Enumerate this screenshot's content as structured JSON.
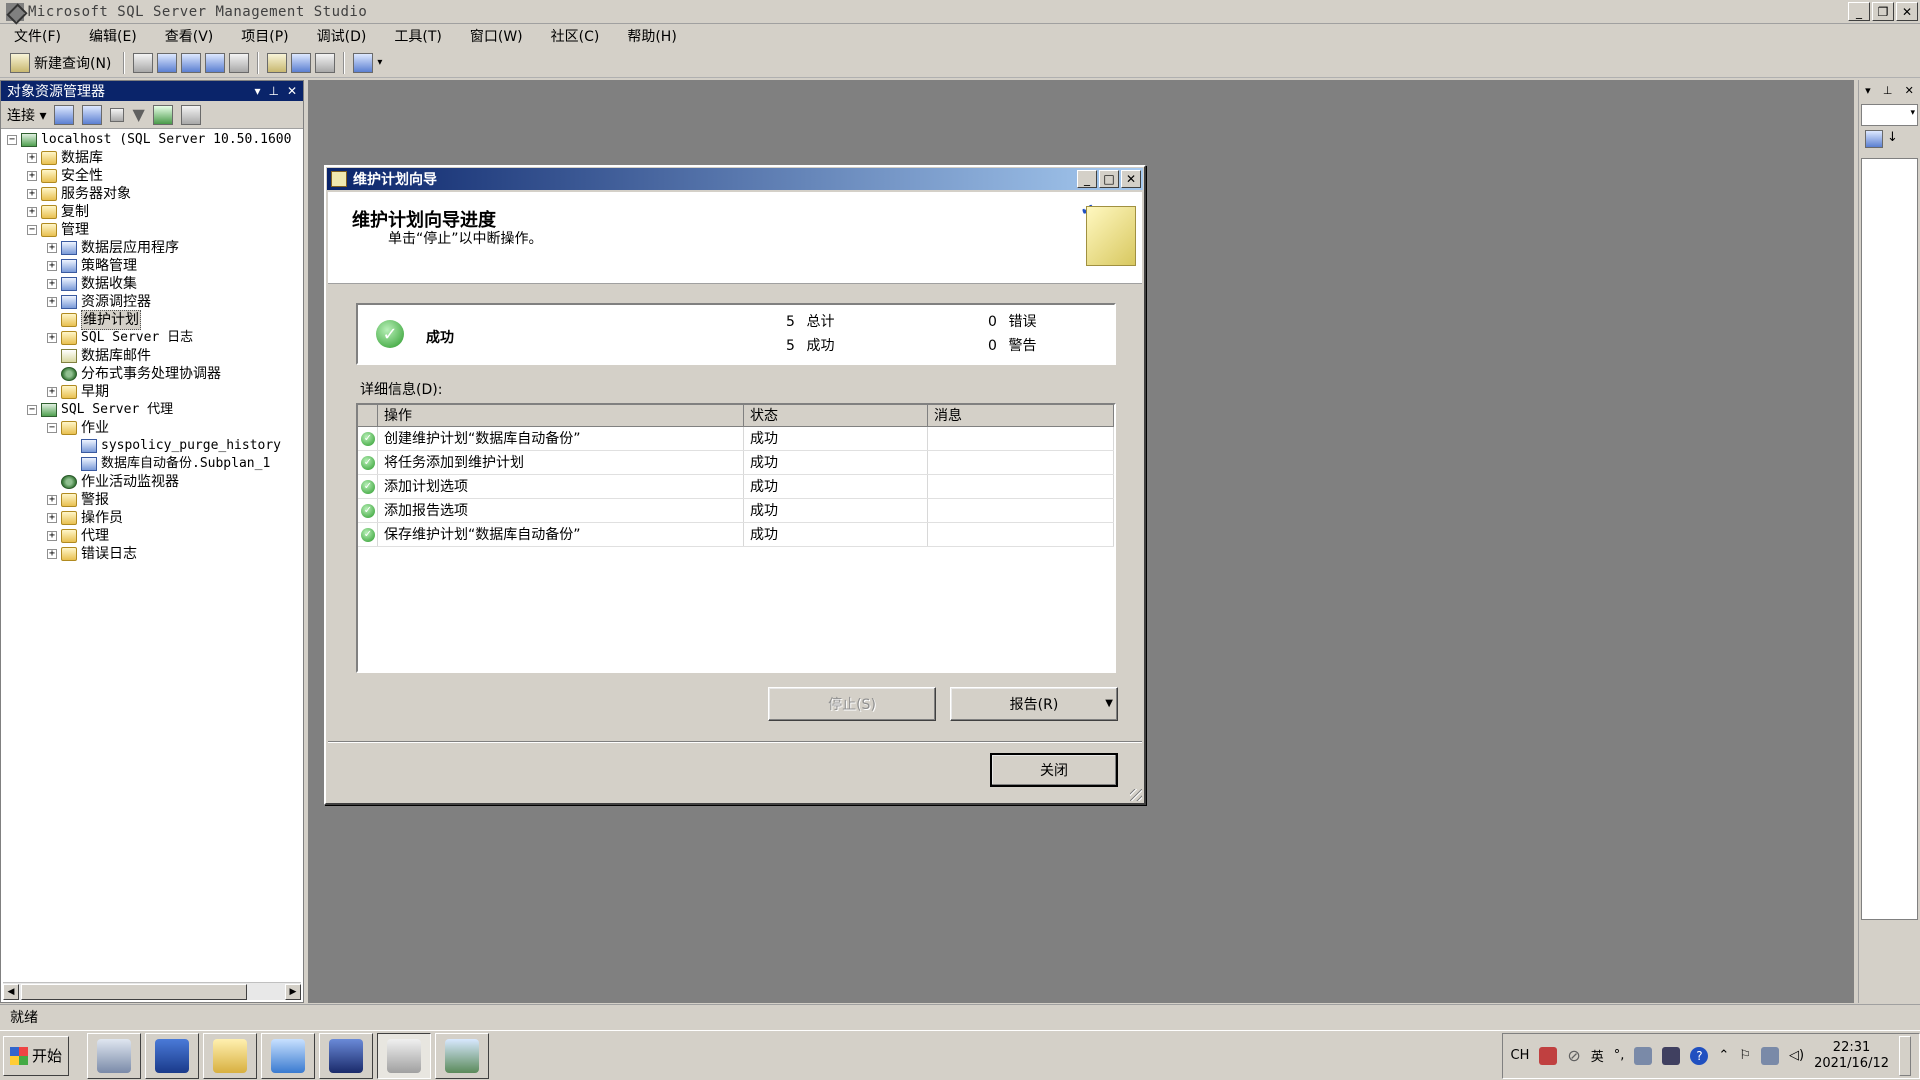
{
  "window": {
    "title": "Microsoft SQL Server Management Studio"
  },
  "menu": [
    "文件(F)",
    "编辑(E)",
    "查看(V)",
    "项目(P)",
    "调试(D)",
    "工具(T)",
    "窗口(W)",
    "社区(C)",
    "帮助(H)"
  ],
  "toolbar": {
    "new_query": "新建查询(N)"
  },
  "object_explorer": {
    "title": "对象资源管理器",
    "connect": "连接",
    "server": "localhost (SQL Server 10.50.1600",
    "nodes": {
      "databases": "数据库",
      "security": "安全性",
      "server_objects": "服务器对象",
      "replication": "复制",
      "management": "管理",
      "data_tier": "数据层应用程序",
      "policy": "策略管理",
      "data_collection": "数据收集",
      "resource_governor": "资源调控器",
      "maintenance_plans": "维护计划",
      "sql_logs": "SQL Server 日志",
      "db_mail": "数据库邮件",
      "dtc": "分布式事务处理协调器",
      "legacy": "早期",
      "agent": "SQL Server 代理",
      "jobs": "作业",
      "job1": "syspolicy_purge_history",
      "job2": "数据库自动备份.Subplan_1",
      "job_monitor": "作业活动监视器",
      "alerts": "警报",
      "operators": "操作员",
      "proxies": "代理",
      "error_logs": "错误日志"
    }
  },
  "status": {
    "text": "就绪"
  },
  "dialog": {
    "title": "维护计划向导",
    "header_title": "维护计划向导进度",
    "header_sub": "单击“停止”以中断操作。",
    "summary": {
      "status": "成功",
      "total_n": "5",
      "total_label": "总计",
      "success_n": "5",
      "success_label": "成功",
      "error_n": "0",
      "error_label": "错误",
      "warning_n": "0",
      "warning_label": "警告"
    },
    "details_label": "详细信息(D):",
    "columns": [
      "操作",
      "状态",
      "消息"
    ],
    "rows": [
      {
        "action": "创建维护计划“数据库自动备份”",
        "status": "成功",
        "message": ""
      },
      {
        "action": "将任务添加到维护计划",
        "status": "成功",
        "message": ""
      },
      {
        "action": "添加计划选项",
        "status": "成功",
        "message": ""
      },
      {
        "action": "添加报告选项",
        "status": "成功",
        "message": ""
      },
      {
        "action": "保存维护计划“数据库自动备份”",
        "status": "成功",
        "message": ""
      }
    ],
    "stop_button": "停止(S)",
    "report_button": "报告(R)",
    "close_button": "关闭"
  },
  "taskbar": {
    "start": "开始",
    "lang": "CH",
    "ime": "英",
    "time": "22:31",
    "date": "2021/16/12"
  },
  "colors": {
    "title_active": "#0a246a",
    "mdi_background": "#808080",
    "ok_green": "#2a9a2a"
  }
}
